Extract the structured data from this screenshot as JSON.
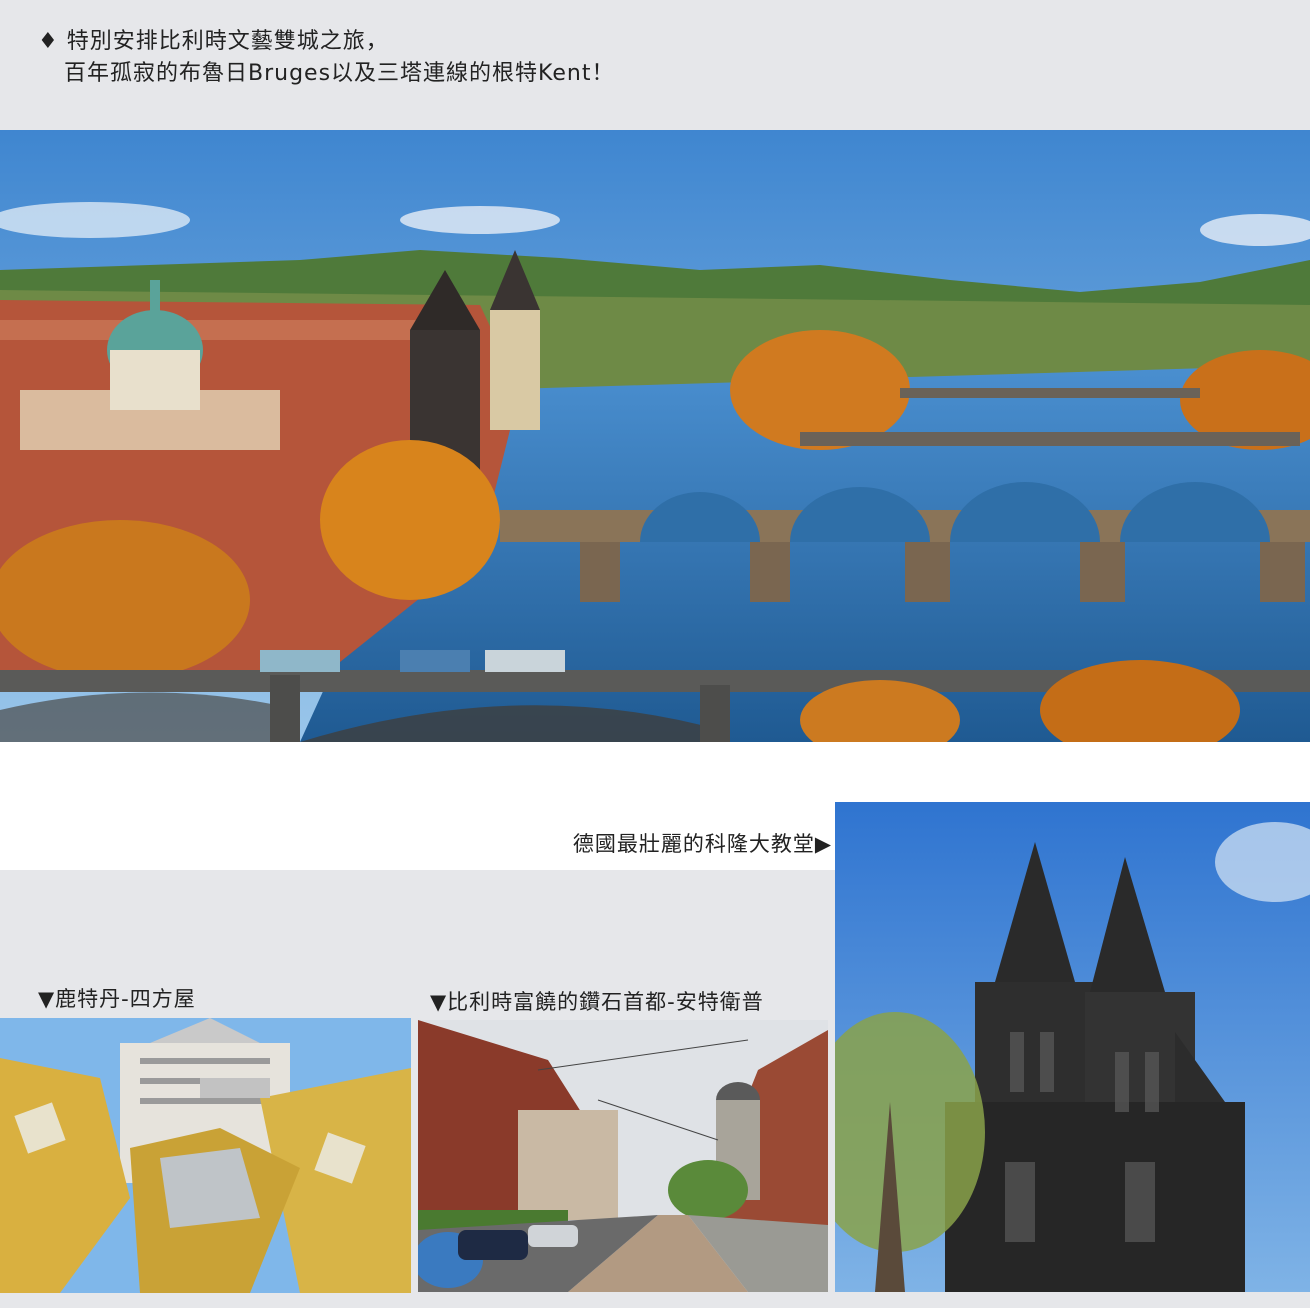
{
  "intro": {
    "bullet": "♦",
    "line1": "特別安排比利時文藝雙城之旅，",
    "line2": "百年孤寂的布魯日Bruges以及三塔連線的根特Kent！"
  },
  "captions": {
    "cologne": "德國最壯麗的科隆大教堂▶",
    "rotterdam": "▼鹿特丹-四方屋",
    "antwerp": "▼比利時富饒的鑽石首都-安特衛普"
  },
  "colors": {
    "band_gray": "#e6e7ea",
    "band_white": "#ffffff",
    "sky": "#5f9fdc",
    "river": "#2f6fa8",
    "autumn": "#d48a20",
    "cube_yellow": "#d9b040",
    "brick": "#8a3a2a",
    "cathedral": "#2a2a2a"
  }
}
